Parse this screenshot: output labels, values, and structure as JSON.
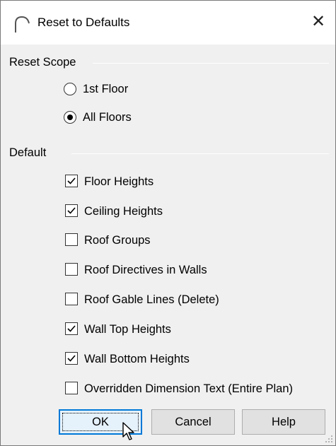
{
  "window": {
    "title": "Reset to Defaults",
    "close_symbol": "✕"
  },
  "reset_scope": {
    "label": "Reset Scope",
    "options": [
      {
        "label": "1st Floor",
        "selected": false
      },
      {
        "label": "All Floors",
        "selected": true
      }
    ]
  },
  "default": {
    "label": "Default",
    "items": [
      {
        "label": "Floor Heights",
        "checked": true
      },
      {
        "label": "Ceiling Heights",
        "checked": true
      },
      {
        "label": "Roof Groups",
        "checked": false
      },
      {
        "label": "Roof Directives in Walls",
        "checked": false
      },
      {
        "label": "Roof Gable Lines (Delete)",
        "checked": false
      },
      {
        "label": "Wall Top Heights",
        "checked": true
      },
      {
        "label": "Wall Bottom Heights",
        "checked": true
      },
      {
        "label": "Overridden Dimension Text (Entire Plan)",
        "checked": false
      }
    ]
  },
  "buttons": {
    "ok": "OK",
    "cancel": "Cancel",
    "help": "Help"
  },
  "colors": {
    "accent": "#0078d7",
    "dialog_bg": "#f0f0f0"
  }
}
